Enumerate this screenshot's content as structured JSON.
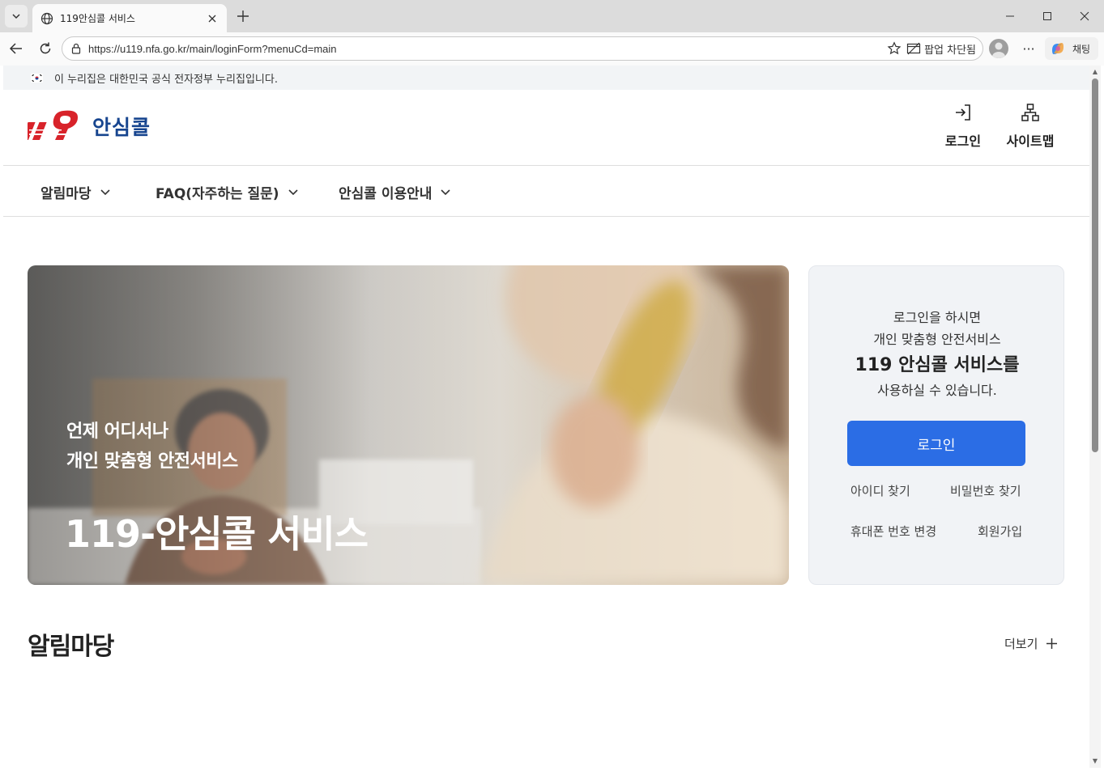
{
  "browser": {
    "tab_title": "119안심콜 서비스",
    "url": "https://u119.nfa.go.kr/main/loginForm?menuCd=main",
    "popup_blocked_label": "팝업 차단됨",
    "copilot_label": "채팅"
  },
  "gov_banner": {
    "text": "이 누리집은 대한민국 공식 전자정부 누리집입니다."
  },
  "header": {
    "logo_text": "안심콜",
    "login_label": "로그인",
    "sitemap_label": "사이트맵"
  },
  "gnb": {
    "items": [
      {
        "label": "알림마당"
      },
      {
        "label": "FAQ(자주하는 질문)"
      },
      {
        "label": "안심콜 이용안내"
      }
    ]
  },
  "hero": {
    "line1": "언제 어디서나",
    "line2": "개인 맞춤형 안전서비스",
    "title": "119-안심콜 서비스"
  },
  "login_box": {
    "line1": "로그인을 하시면",
    "line2": "개인 맞춤형 안전서비스",
    "line3": "119 안심콜 서비스를",
    "line4": "사용하실 수 있습니다.",
    "login_button": "로그인",
    "find_id": "아이디 찾기",
    "find_password": "비밀번호 찾기",
    "change_phone": "휴대폰 번호 변경",
    "signup": "회원가입"
  },
  "notice": {
    "title": "알림마당",
    "more": "더보기"
  },
  "colors": {
    "primary": "#2b6de5",
    "logo_red": "#d8232a",
    "logo_blue": "#17458f",
    "panel_bg": "#f1f3f6"
  }
}
